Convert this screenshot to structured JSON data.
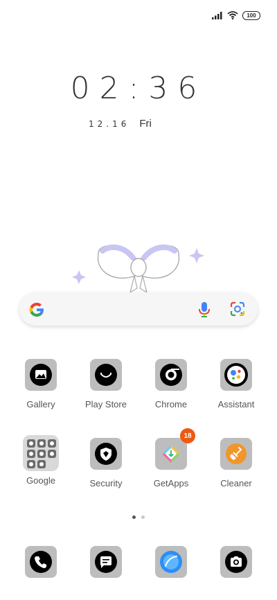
{
  "status_bar": {
    "battery_level": "100",
    "signal_icon": "signal-bars-icon",
    "wifi_icon": "wifi-icon"
  },
  "clock": {
    "time": "02:36",
    "date": "12.16",
    "weekday": "Fri"
  },
  "search_bar": {
    "logo_icon": "google-g-icon",
    "mic_icon": "microphone-icon",
    "lens_icon": "google-lens-icon"
  },
  "apps": {
    "gallery": {
      "label": "Gallery",
      "icon": "image-icon"
    },
    "play_store": {
      "label": "Play Store",
      "icon": "smile-bag-icon"
    },
    "chrome": {
      "label": "Chrome",
      "icon": "chrome-icon"
    },
    "assistant": {
      "label": "Assistant",
      "icon": "assistant-dots-icon"
    },
    "google": {
      "label": "Google",
      "icon": "folder-icon"
    },
    "security": {
      "label": "Security",
      "icon": "shield-icon"
    },
    "getapps": {
      "label": "GetApps",
      "icon": "getapps-icon",
      "badge": "18"
    },
    "cleaner": {
      "label": "Cleaner",
      "icon": "broom-icon"
    }
  },
  "page_indicator": {
    "current": 1,
    "total": 2
  },
  "dock": [
    {
      "name": "phone",
      "icon": "phone-icon"
    },
    {
      "name": "messages",
      "icon": "message-icon"
    },
    {
      "name": "browser",
      "icon": "browser-icon"
    },
    {
      "name": "camera",
      "icon": "camera-icon"
    }
  ],
  "colors": {
    "tile_gray": "#bdbdbd",
    "badge_orange": "#ec5a12",
    "google_blue": "#4285F4",
    "google_red": "#EA4335",
    "google_yellow": "#FBBC05",
    "google_green": "#34A853"
  }
}
